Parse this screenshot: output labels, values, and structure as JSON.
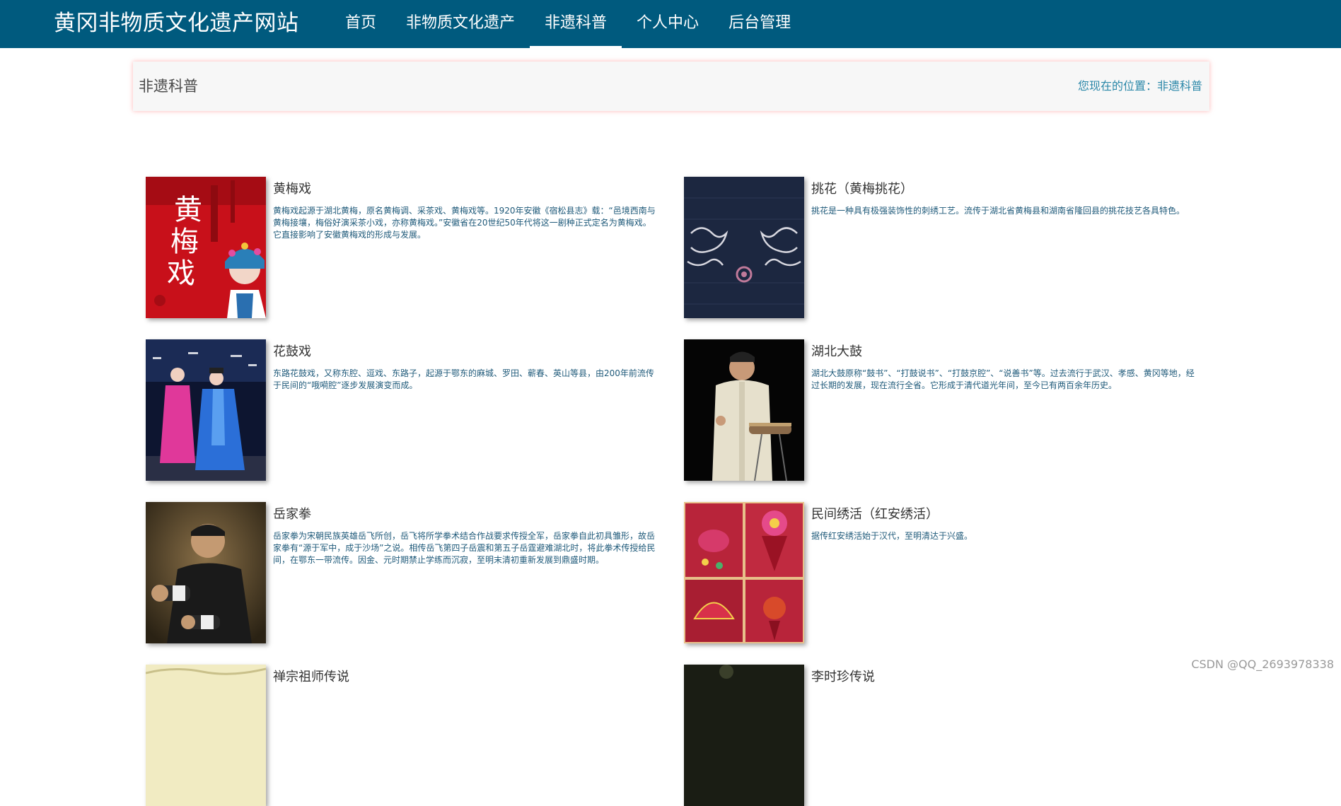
{
  "site": {
    "title": "黄冈非物质文化遗产网站"
  },
  "nav": {
    "items": [
      {
        "label": "首页"
      },
      {
        "label": "非物质文化遗产"
      },
      {
        "label": "非遗科普"
      },
      {
        "label": "个人中心"
      },
      {
        "label": "后台管理"
      }
    ],
    "active": "非遗科普"
  },
  "header": {
    "title": "非遗科普",
    "breadcrumb": "您现在的位置：非遗科普"
  },
  "cards": [
    {
      "title": "黄梅戏",
      "desc": "黄梅戏起源于湖北黄梅，原名黄梅调、采茶戏、黄梅戏等。1920年安徽《宿松县志》载：“邑境西南与黄梅接壤，梅俗好演采茶小戏，亦称黄梅戏。”安徽省在20世纪50年代将这一剧种正式定名为黄梅戏。它直接影响了安徽黄梅戏的形成与发展。",
      "image": "huangmeixi-poster"
    },
    {
      "title": "挑花（黄梅挑花）",
      "desc": "挑花是一种具有极强装饰性的刺绣工艺。流传于湖北省黄梅县和湖南省隆回县的挑花技艺各具特色。",
      "image": "embroidery-dragons"
    },
    {
      "title": "花鼓戏",
      "desc": "东路花鼓戏，又称东腔、逗戏、东路子，起源于鄂东的麻城、罗田、蕲春、英山等县，由200年前流传于民间的“哦嗬腔”逐步发展演变而成。",
      "image": "opera-performers"
    },
    {
      "title": "湖北大鼓",
      "desc": "湖北大鼓原称“鼓书”、“打鼓说书”、“打鼓京腔”、“说善书”等。过去流行于武汉、孝感、黄冈等地，经过长期的发展，现在流行全省。它形成于清代道光年间，至今已有两百余年历史。",
      "image": "drum-performer"
    },
    {
      "title": "岳家拳",
      "desc": "岳家拳为宋朝民族英雄岳飞所创，岳飞将所学拳术结合作战要求传授全军，岳家拳自此初具雏形，故岳家拳有“源于军中，成于沙场”之说。相传岳飞第四子岳震和第五子岳霆避难湖北时，将此拳术传授给民间，在鄂东一带流传。因金、元时期禁止学练而沉寂，至明末清初重新发展到鼎盛时期。",
      "image": "martial-artist"
    },
    {
      "title": "民间绣活（红安绣活）",
      "desc": "据传红安绣活始于汉代，至明清达于兴盛。",
      "image": "red-crafts-grid"
    },
    {
      "title": "禅宗祖师传说",
      "desc": "",
      "image": "zen-painting"
    },
    {
      "title": "李时珍传说",
      "desc": "",
      "image": "dark-photo"
    }
  ],
  "watermark": "CSDN @QQ_2693978338"
}
